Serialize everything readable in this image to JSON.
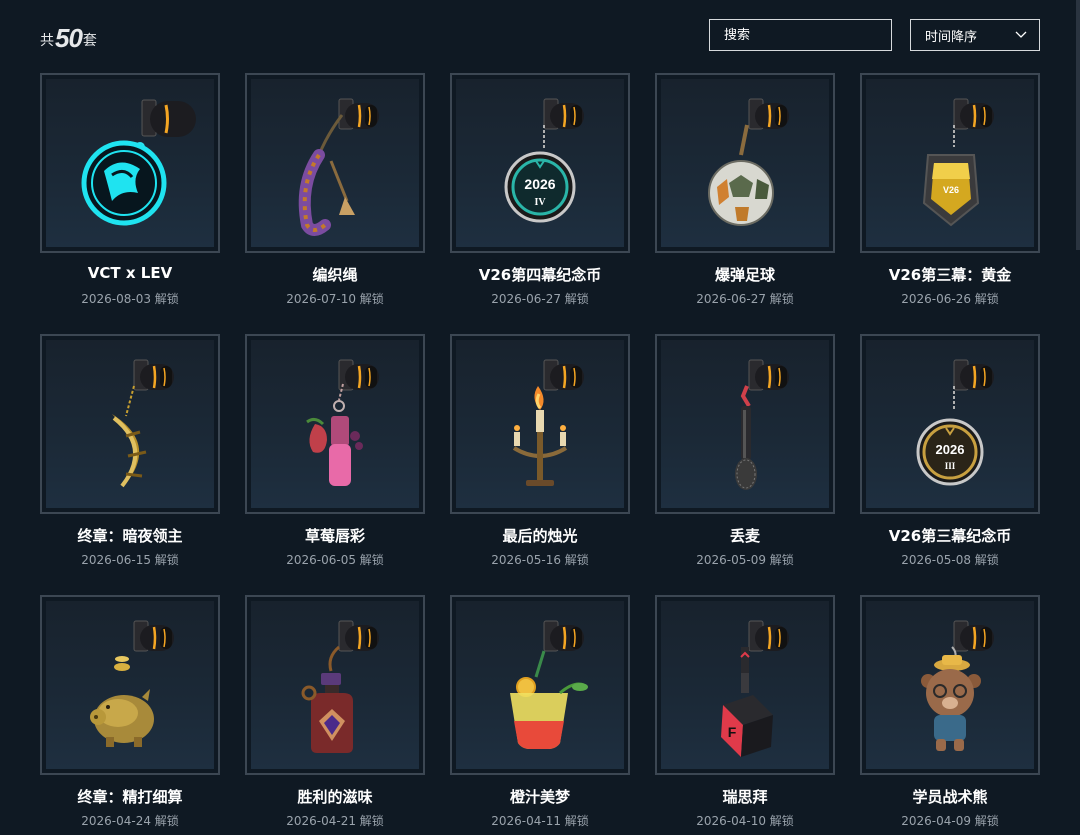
{
  "header": {
    "count_prefix": "共",
    "count_value": "50",
    "count_suffix": "套",
    "search_placeholder": "搜索",
    "sort_label": "时间降序"
  },
  "colors": {
    "background": "#0f1923",
    "card_border": "#3c4753",
    "date_text": "#9aa3ac",
    "accent_orange": "#f5a623"
  },
  "items": [
    {
      "name": "VCT x LEV",
      "date": "2026-08-03 解锁",
      "icon": "coin-dragon-icon"
    },
    {
      "name": "编织绳",
      "date": "2026-07-10 解锁",
      "icon": "braided-rope-icon"
    },
    {
      "name": "V26第四幕纪念币",
      "date": "2026-06-27 解锁",
      "icon": "coin-2026-iv-icon"
    },
    {
      "name": "爆弹足球",
      "date": "2026-06-27 解锁",
      "icon": "soccer-ball-icon"
    },
    {
      "name": "V26第三幕：黄金",
      "date": "2026-06-26 解锁",
      "icon": "gold-badge-icon"
    },
    {
      "name": "终章：暗夜领主",
      "date": "2026-06-15 解锁",
      "icon": "golden-crescent-icon"
    },
    {
      "name": "草莓唇彩",
      "date": "2026-06-05 解锁",
      "icon": "strawberry-lipgloss-icon"
    },
    {
      "name": "最后的烛光",
      "date": "2026-05-16 解锁",
      "icon": "candelabra-icon"
    },
    {
      "name": "丢麦",
      "date": "2026-05-09 解锁",
      "icon": "microphone-icon"
    },
    {
      "name": "V26第三幕纪念币",
      "date": "2026-05-08 解锁",
      "icon": "coin-2026-iii-icon"
    },
    {
      "name": "终章：精打细算",
      "date": "2026-04-24 解锁",
      "icon": "piggy-bank-icon"
    },
    {
      "name": "胜利的滋味",
      "date": "2026-04-21 解锁",
      "icon": "potion-bottle-icon"
    },
    {
      "name": "橙汁美梦",
      "date": "2026-04-11 解锁",
      "icon": "cocktail-icon"
    },
    {
      "name": "瑞思拜",
      "date": "2026-04-10 解锁",
      "icon": "red-cube-icon"
    },
    {
      "name": "学员战术熊",
      "date": "2026-04-09 解锁",
      "icon": "bear-icon"
    }
  ]
}
